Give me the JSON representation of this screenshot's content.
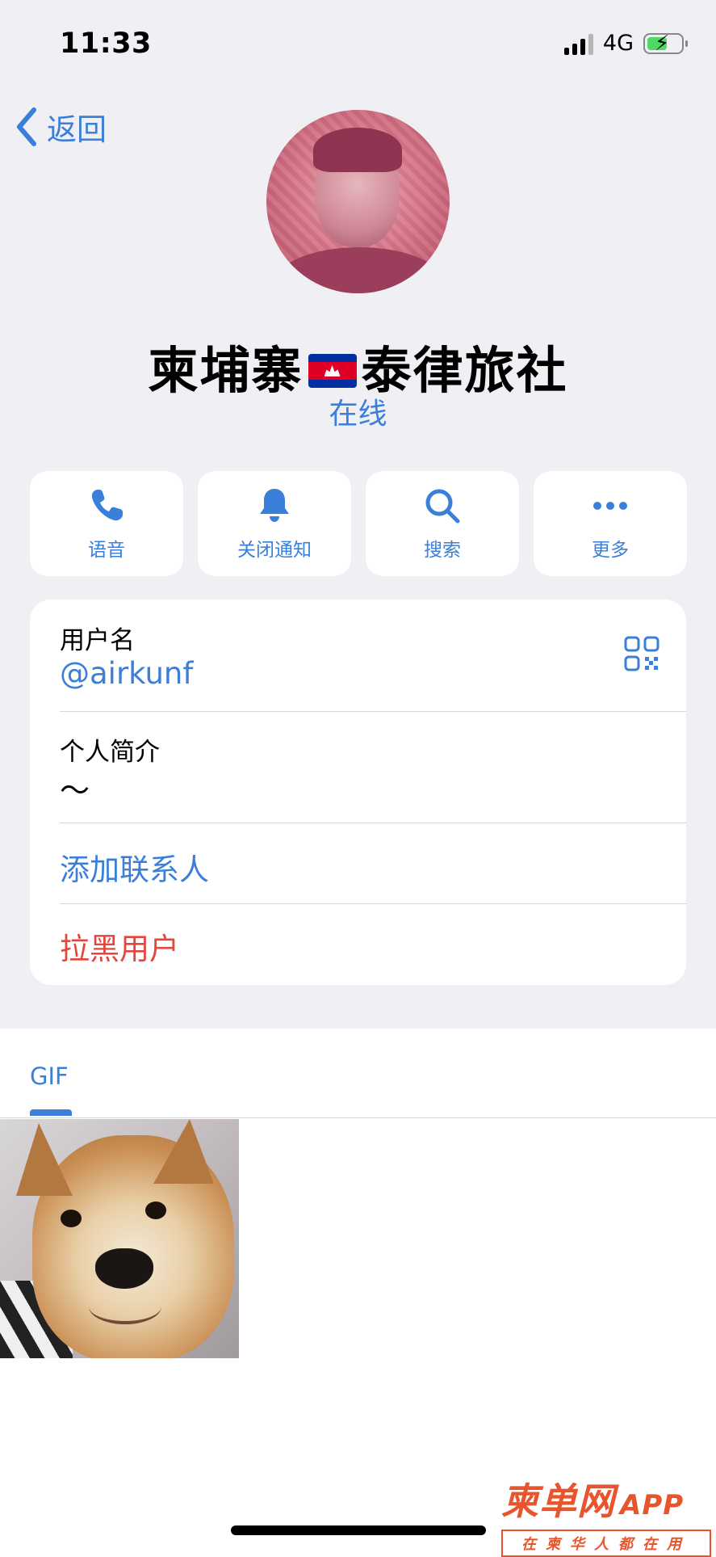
{
  "status_bar": {
    "time": "11:33",
    "network": "4G"
  },
  "nav": {
    "back_label": "返回"
  },
  "profile": {
    "name_before_flag": "柬埔寨",
    "name_after_flag": "泰律旅社",
    "status": "在线"
  },
  "actions": [
    {
      "label": "语音",
      "icon": "phone-icon"
    },
    {
      "label": "关闭通知",
      "icon": "bell-icon"
    },
    {
      "label": "搜索",
      "icon": "search-icon"
    },
    {
      "label": "更多",
      "icon": "more-icon"
    }
  ],
  "info": {
    "username_label": "用户名",
    "username_value": "@airkunf",
    "bio_label": "个人简介",
    "bio_value": "～",
    "add_contact": "添加联系人",
    "block_user": "拉黑用户"
  },
  "media": {
    "tab_label": "GIF"
  },
  "watermark": {
    "main": "柬单网",
    "app": "APP",
    "sub": "在柬华人都在用"
  },
  "colors": {
    "accent": "#3a7fd9",
    "danger": "#e5453d",
    "background": "#efeff4",
    "watermark": "#e8552c"
  }
}
